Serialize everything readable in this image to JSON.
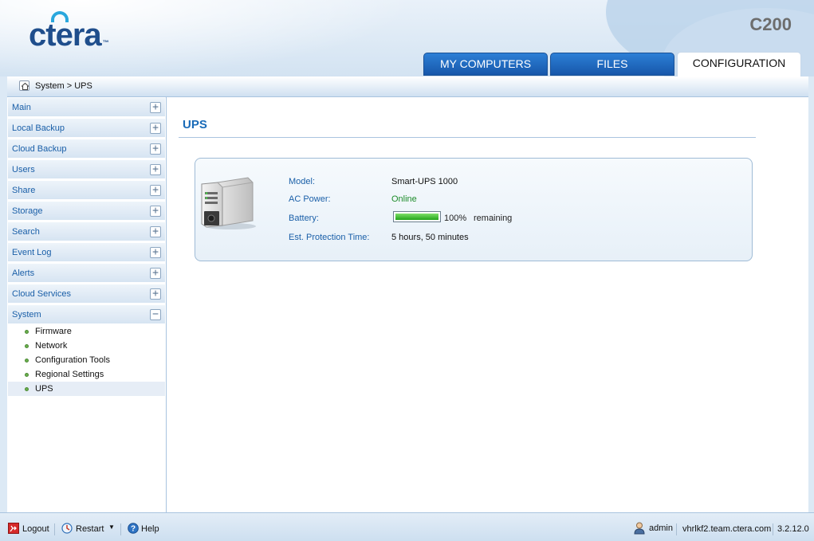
{
  "header": {
    "logo_text": "ctera",
    "logo_tm": "™",
    "model": "C200",
    "tabs": [
      {
        "label": "MY COMPUTERS",
        "active": false
      },
      {
        "label": "FILES",
        "active": false
      },
      {
        "label": "CONFIGURATION",
        "active": true
      }
    ]
  },
  "breadcrumb": {
    "text": "System > UPS"
  },
  "sidebar": {
    "sections": [
      {
        "label": "Main",
        "toggle": "+"
      },
      {
        "label": "Local Backup",
        "toggle": "+"
      },
      {
        "label": "Cloud Backup",
        "toggle": "+"
      },
      {
        "label": "Users",
        "toggle": "+"
      },
      {
        "label": "Share",
        "toggle": "+"
      },
      {
        "label": "Storage",
        "toggle": "+"
      },
      {
        "label": "Search",
        "toggle": "+"
      },
      {
        "label": "Event Log",
        "toggle": "+"
      },
      {
        "label": "Alerts",
        "toggle": "+"
      },
      {
        "label": "Cloud Services",
        "toggle": "+"
      },
      {
        "label": "System",
        "toggle": "−"
      }
    ],
    "system_items": [
      {
        "label": "Firmware"
      },
      {
        "label": "Network"
      },
      {
        "label": "Configuration Tools"
      },
      {
        "label": "Regional Settings"
      },
      {
        "label": "UPS",
        "selected": true
      }
    ]
  },
  "main": {
    "title": "UPS",
    "ups": {
      "model_label": "Model:",
      "model_value": "Smart-UPS 1000",
      "ac_label": "AC Power:",
      "ac_value": "Online",
      "battery_label": "Battery:",
      "battery_level": 1.0,
      "battery_percent": "100%",
      "battery_suffix": "remaining",
      "est_label": "Est. Protection Time:",
      "est_value": "5 hours, 50 minutes"
    }
  },
  "footer": {
    "logout": "Logout",
    "restart": "Restart",
    "help": "Help",
    "user": "admin",
    "host": "vhrlkf2.team.ctera.com",
    "version": "3.2.12.0"
  },
  "colors": {
    "tab_blue": "#1f6cc4",
    "link_blue": "#1a5fa8",
    "online_green": "#1d8c2a"
  }
}
